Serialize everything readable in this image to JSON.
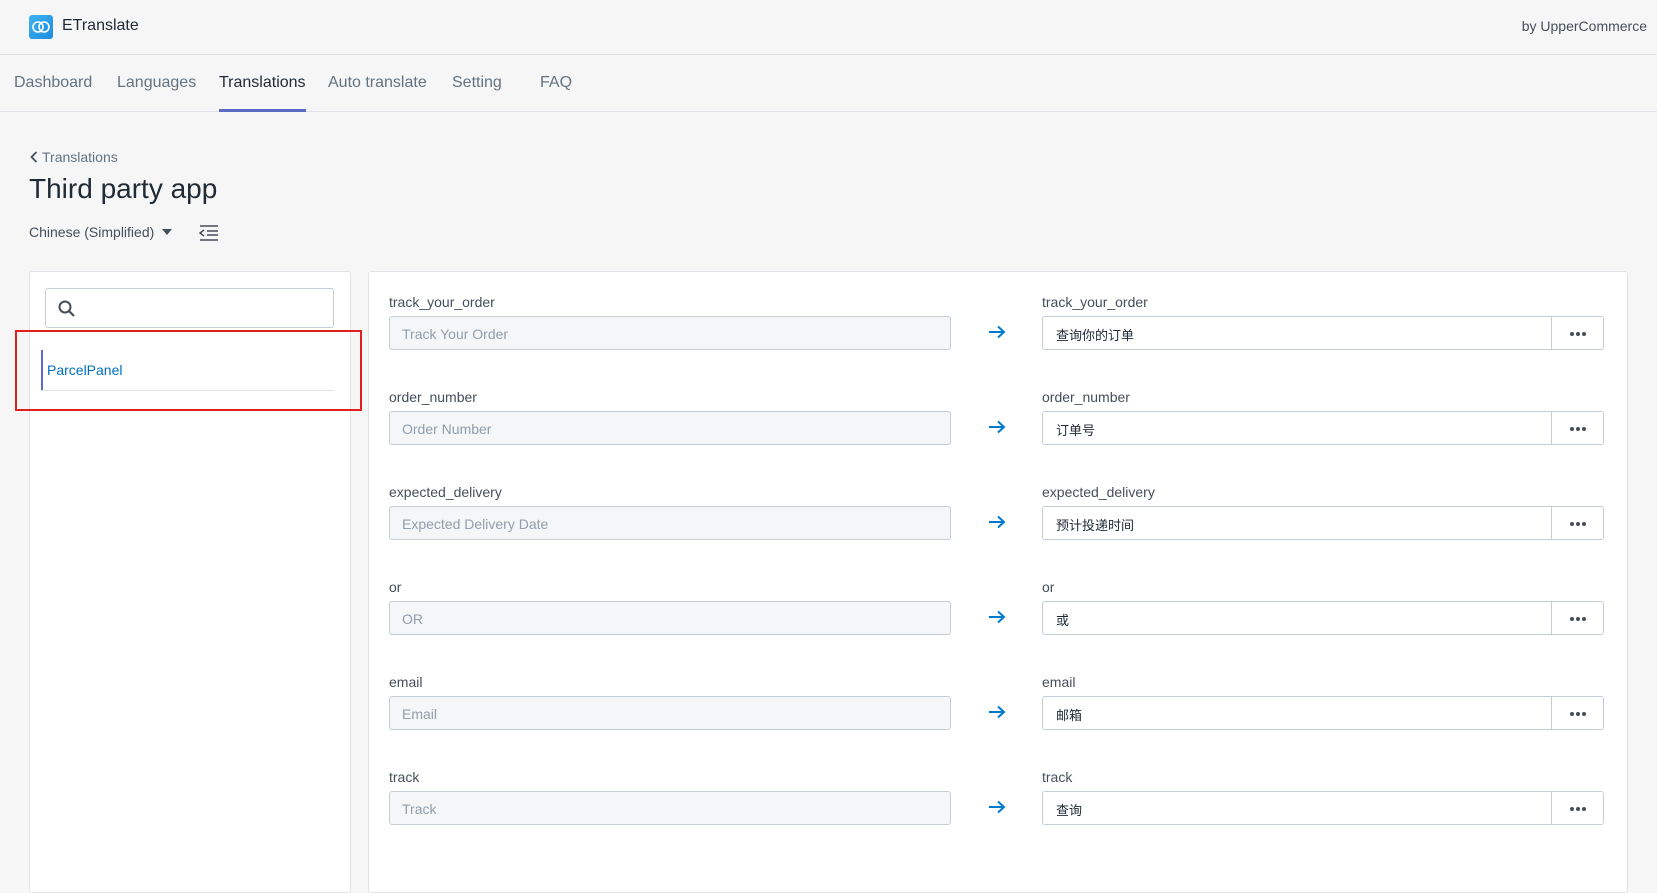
{
  "header": {
    "app_name": "ETranslate",
    "by_line": "by UpperCommerce"
  },
  "nav": {
    "tabs": [
      {
        "label": "Dashboard"
      },
      {
        "label": "Languages"
      },
      {
        "label": "Translations",
        "active": true
      },
      {
        "label": "Auto translate"
      },
      {
        "label": "Setting"
      },
      {
        "label": "FAQ"
      }
    ]
  },
  "page": {
    "breadcrumb": "Translations",
    "title": "Third party app",
    "language": "Chinese (Simplified)"
  },
  "sidebar": {
    "search_placeholder": "",
    "apps": [
      {
        "label": "ParcelPanel",
        "selected": true
      }
    ]
  },
  "translations": [
    {
      "key": "track_your_order",
      "source": "Track Your Order",
      "target": "查询你的订单"
    },
    {
      "key": "order_number",
      "source": "Order Number",
      "target": "订单号"
    },
    {
      "key": "expected_delivery",
      "source": "Expected Delivery Date",
      "target": "预计投递时间"
    },
    {
      "key": "or",
      "source": "OR",
      "target": "或"
    },
    {
      "key": "email",
      "source": "Email",
      "target": "邮箱"
    },
    {
      "key": "track",
      "source": "Track",
      "target": "查询"
    }
  ],
  "colors": {
    "accent": "#5c6ac4",
    "link": "#006fbb",
    "arrow": "#007ace",
    "highlight": "#e02020"
  }
}
